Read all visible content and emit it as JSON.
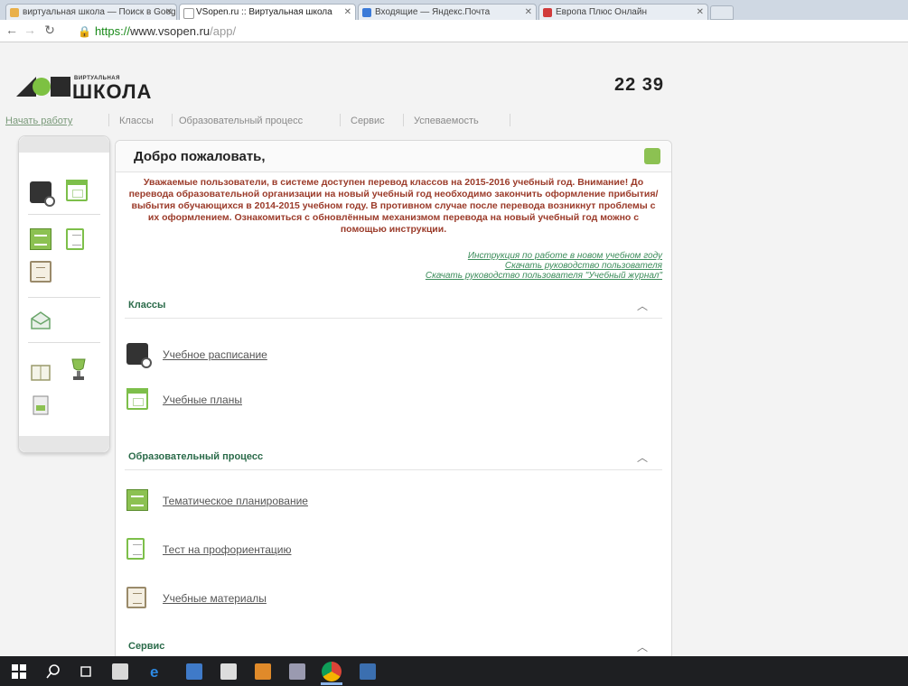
{
  "browser": {
    "tabs": [
      {
        "label": "виртуальная школа — Поиск в Google",
        "active": false
      },
      {
        "label": "VSopen.ru :: Виртуальная школа",
        "active": true
      },
      {
        "label": "Входящие — Яндекс.Почта",
        "active": false
      },
      {
        "label": "Европа Плюс Онлайн",
        "active": false
      }
    ],
    "url": {
      "scheme": "https://",
      "host": "www.vsopen.ru",
      "path": "/app/"
    }
  },
  "header": {
    "logo_small": "ВИРТУАЛЬНАЯ",
    "logo_big": "ШКОЛА",
    "clock": "22 39"
  },
  "menu": {
    "items": [
      "Начать работу",
      "Классы",
      "Образовательный процесс",
      "Сервис",
      "Успеваемость"
    ]
  },
  "main": {
    "title": "Добро пожаловать,",
    "notice": "Уважаемые пользователи, в системе доступен перевод классов на 2015-2016 учебный год. Внимание! До перевода образовательной организации на новый учебный год необходимо закончить оформление прибытия/выбытия обучающихся в 2014-2015 учебном году. В противном случае после перевода возникнут проблемы с их оформлением. Ознакомиться с обновлённым механизмом перевода на новый учебный год можно с помощью инструкции.",
    "links": [
      "Инструкция по работе в новом учебном году",
      "Скачать руководство пользователя",
      "Скачать руководство пользователя \"Учебный журнал\""
    ],
    "sections": [
      {
        "title": "Классы",
        "items": [
          "Учебное расписание",
          "Учебные планы"
        ]
      },
      {
        "title": "Образовательный процесс",
        "items": [
          "Тематическое планирование",
          "Тест на профориентацию",
          "Учебные материалы"
        ]
      },
      {
        "title": "Сервис",
        "items": []
      }
    ]
  },
  "colors": {
    "brand_green": "#7dc142",
    "notice_text": "#9b3b2a",
    "link_green": "#3b8c5a",
    "taskbar": "#1e1f22"
  }
}
